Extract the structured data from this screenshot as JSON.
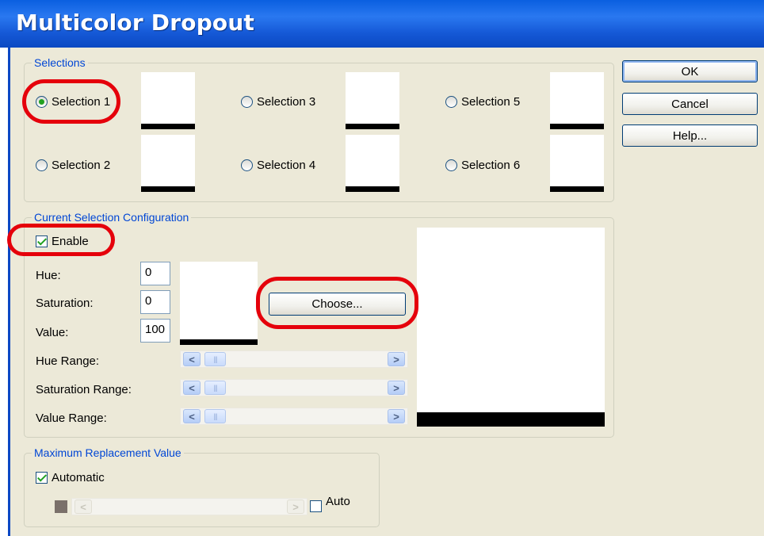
{
  "dialog": {
    "title": "Multicolor Dropout"
  },
  "selections": {
    "legend": "Selections",
    "items": [
      {
        "label": "Selection 1",
        "checked": true
      },
      {
        "label": "Selection 2",
        "checked": false
      },
      {
        "label": "Selection 3",
        "checked": false
      },
      {
        "label": "Selection 4",
        "checked": false
      },
      {
        "label": "Selection 5",
        "checked": false
      },
      {
        "label": "Selection 6",
        "checked": false
      }
    ]
  },
  "buttons": {
    "ok": "OK",
    "cancel": "Cancel",
    "help": "Help..."
  },
  "config": {
    "legend": "Current Selection Configuration",
    "enable_label": "Enable",
    "enable_checked": true,
    "hue_label": "Hue:",
    "hue_value": "0",
    "saturation_label": "Saturation:",
    "saturation_value": "0",
    "value_label": "Value:",
    "value_value": "100",
    "choose_label": "Choose...",
    "hue_range_label": "Hue Range:",
    "saturation_range_label": "Saturation Range:",
    "value_range_label": "Value Range:"
  },
  "max_replacement": {
    "legend": "Maximum Replacement Value",
    "automatic_label": "Automatic",
    "automatic_checked": true,
    "auto_label": "Auto",
    "auto_checked": false,
    "swatch_color": "#7a706a"
  },
  "colors": {
    "titlebar": "#1558d6",
    "dialog_bg": "#ece9d8",
    "group_legend": "#0046d5",
    "highlight": "#e5000b"
  }
}
